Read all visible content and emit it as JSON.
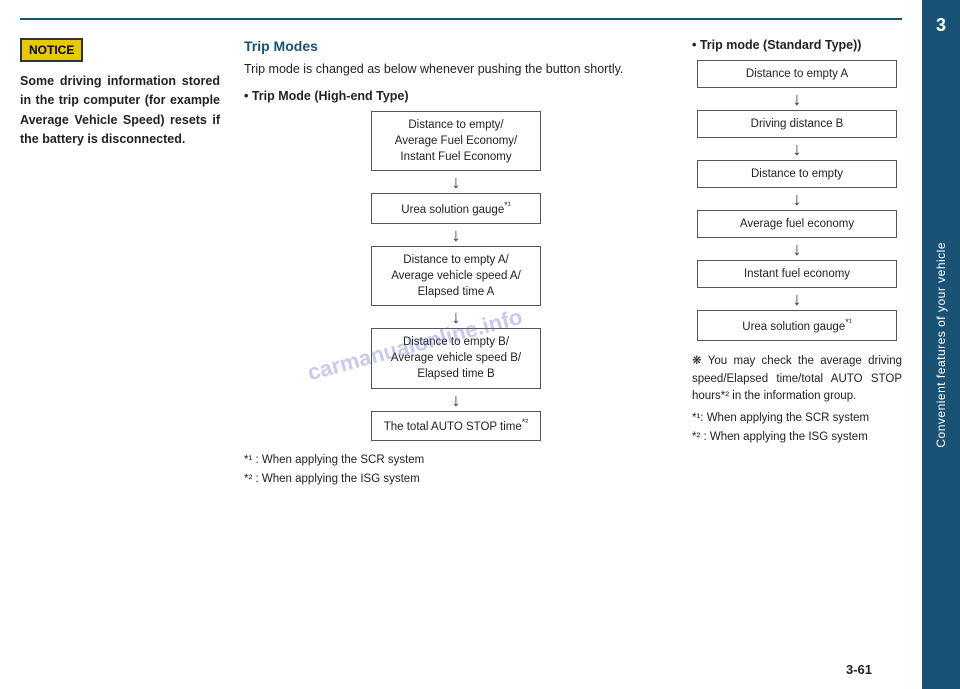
{
  "page": {
    "page_number": "3-61",
    "top_line_visible": true
  },
  "sidebar": {
    "chapter_number": "3",
    "chapter_label": "Convenient features of your vehicle"
  },
  "left_column": {
    "notice_label": "NOTICE",
    "notice_text": "Some driving information stored in the trip computer (for example Average Vehicle Speed) resets if the battery is disconnected."
  },
  "middle_column": {
    "section_title": "Trip Modes",
    "intro_text": "Trip mode is changed as below whenever pushing the button shortly.",
    "high_end_title": "• Trip Mode (High-end Type)",
    "high_end_flow": [
      {
        "lines": [
          "Distance to empty/",
          "Average Fuel Economy/",
          "Instant Fuel Economy"
        ],
        "id": "box-1"
      },
      {
        "lines": [
          "Urea solution gauge*¹"
        ],
        "id": "box-2"
      },
      {
        "lines": [
          "Distance to empty A/",
          "Average vehicle speed A/",
          "Elapsed time A"
        ],
        "id": "box-3"
      },
      {
        "lines": [
          "Distance to empty B/",
          "Average vehicle speed B/",
          "Elapsed time B"
        ],
        "id": "box-4"
      },
      {
        "lines": [
          "The total AUTO STOP time*²"
        ],
        "id": "box-5"
      }
    ],
    "footnote_1": "*¹ : When applying the SCR system",
    "footnote_2": "*² : When applying the ISG system"
  },
  "right_column": {
    "standard_title": "• Trip mode (Standard Type))",
    "standard_flow": [
      {
        "lines": [
          "Distance to empty A"
        ],
        "id": "s-box-1"
      },
      {
        "lines": [
          "Driving distance B"
        ],
        "id": "s-box-2"
      },
      {
        "lines": [
          "Distance to empty"
        ],
        "id": "s-box-3"
      },
      {
        "lines": [
          "Average fuel economy"
        ],
        "id": "s-box-4"
      },
      {
        "lines": [
          "Instant fuel economy"
        ],
        "id": "s-box-5"
      },
      {
        "lines": [
          "Urea solution gauge*¹"
        ],
        "id": "s-box-6"
      }
    ],
    "note_symbol": "❋",
    "note_text": "You may check the average driving speed/Elapsed time/total AUTO STOP hours*² in the information group.",
    "footnote_1": "*¹: When applying the SCR system",
    "footnote_2": "*² : When applying the ISG system"
  },
  "watermark": {
    "text": "carmanualonline.info"
  }
}
